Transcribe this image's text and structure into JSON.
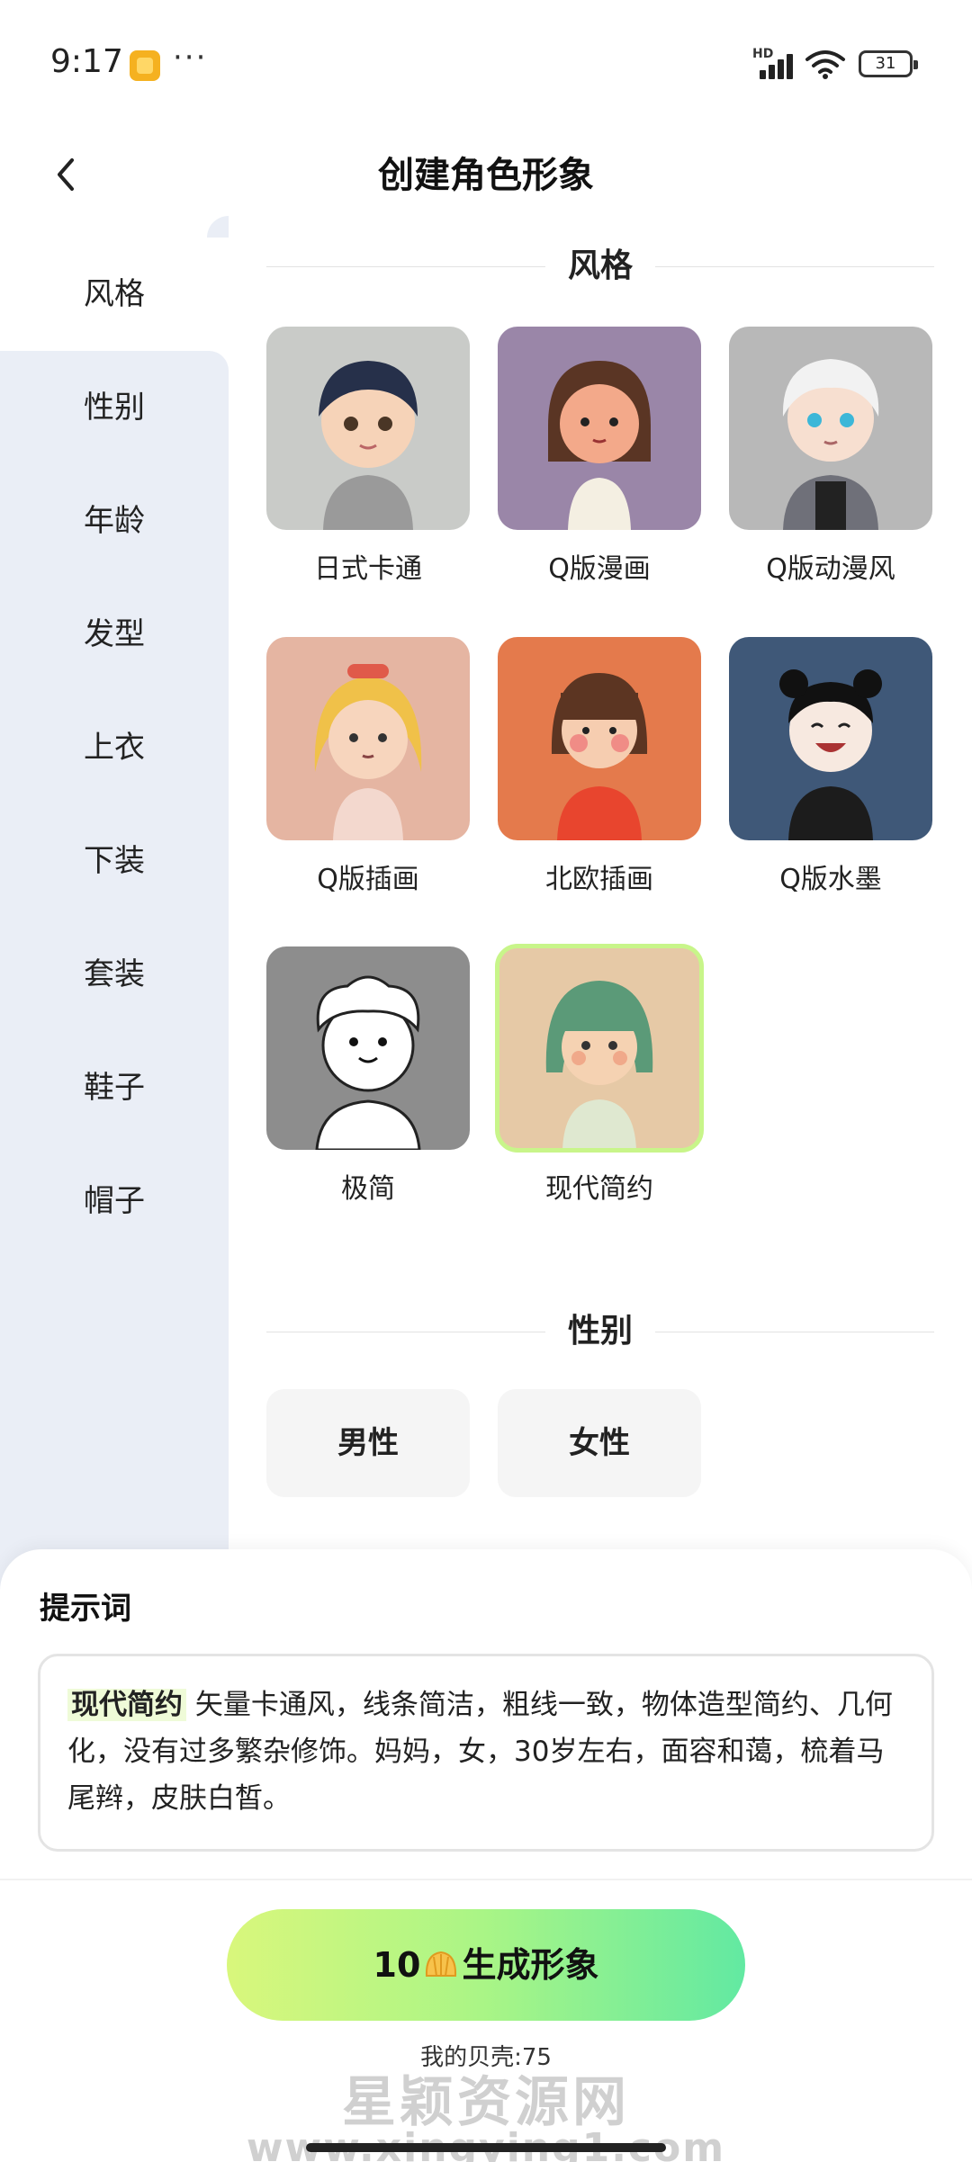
{
  "status_bar": {
    "time": "9:17",
    "more": "···",
    "network": "HD",
    "battery": "31"
  },
  "header": {
    "title": "创建角色形象"
  },
  "sidebar": {
    "items": [
      {
        "label": "风格"
      },
      {
        "label": "性别"
      },
      {
        "label": "年龄"
      },
      {
        "label": "发型"
      },
      {
        "label": "上衣"
      },
      {
        "label": "下装"
      },
      {
        "label": "套装"
      },
      {
        "label": "鞋子"
      },
      {
        "label": "帽子"
      }
    ],
    "active_index": 0
  },
  "style_section": {
    "title": "风格",
    "options": [
      {
        "label": "日式卡通",
        "bg": "#c9cbc8",
        "selected": false
      },
      {
        "label": "Q版漫画",
        "bg": "#9a86a8",
        "selected": false
      },
      {
        "label": "Q版动漫风",
        "bg": "#b8b8b8",
        "selected": false
      },
      {
        "label": "Q版插画",
        "bg": "#e5b5a2",
        "selected": false
      },
      {
        "label": "北欧插画",
        "bg": "#e47a4c",
        "selected": false
      },
      {
        "label": "Q版水墨",
        "bg": "#3f5878",
        "selected": false
      },
      {
        "label": "极简",
        "bg": "#8d8d8d",
        "selected": false
      },
      {
        "label": "现代简约",
        "bg": "#e6c9a6",
        "selected": true
      }
    ]
  },
  "gender_section": {
    "title": "性别",
    "options": [
      {
        "label": "男性"
      },
      {
        "label": "女性"
      }
    ]
  },
  "prompt": {
    "title": "提示词",
    "tag": "现代简约",
    "text": "矢量卡通风，线条简洁，粗线一致，物体造型简约、几何化，没有过多繁杂修饰。妈妈，女，30岁左右，面容和蔼，梳着马尾辫，皮肤白皙。"
  },
  "generate": {
    "cost": "10",
    "label": "生成形象",
    "currency_icon": "shell-icon"
  },
  "balance": {
    "text": "我的贝壳:75"
  },
  "watermark": {
    "text": "星颖资源网",
    "url": "www.xingying1.com"
  },
  "colors": {
    "accent_start": "#d9f77c",
    "accent_end": "#62e9a2",
    "sidebar_bg": "#eaeef6",
    "selected_outline": "#c8f58a"
  }
}
